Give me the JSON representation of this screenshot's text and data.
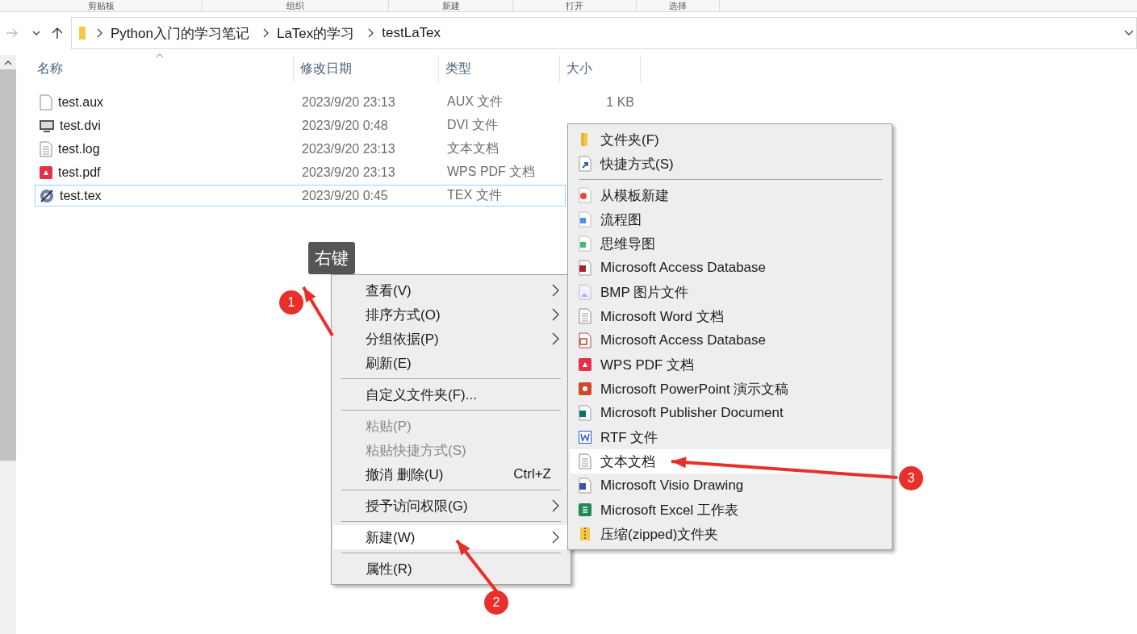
{
  "ribbon_groups": [
    "剪贴板",
    "组织",
    "新建",
    "打开",
    "选择"
  ],
  "breadcrumb": [
    "Python入门的学习笔记",
    "LaTex的学习",
    "testLaTex"
  ],
  "columns": [
    {
      "label": "名称",
      "sorted": true
    },
    {
      "label": "修改日期",
      "sorted": false
    },
    {
      "label": "类型",
      "sorted": false
    },
    {
      "label": "大小",
      "sorted": false
    }
  ],
  "files": [
    {
      "name": "test.aux",
      "date": "2023/9/20 23:13",
      "type": "AUX 文件",
      "size": "1 KB",
      "kind": "blank",
      "selected": false
    },
    {
      "name": "test.dvi",
      "date": "2023/9/20 0:48",
      "type": "DVI 文件",
      "kind": "dvi",
      "selected": false
    },
    {
      "name": "test.log",
      "date": "2023/9/20 23:13",
      "type": "文本文档",
      "kind": "text",
      "selected": false
    },
    {
      "name": "test.pdf",
      "date": "2023/9/20 23:13",
      "type": "WPS PDF 文档",
      "kind": "wpspdf",
      "selected": false
    },
    {
      "name": "test.tex",
      "date": "2023/9/20 0:45",
      "type": "TEX 文件",
      "kind": "tex",
      "selected": true
    }
  ],
  "context_menu": [
    {
      "kind": "item",
      "label": "查看(V)",
      "submenu": true,
      "disabled": false,
      "selected": false
    },
    {
      "kind": "item",
      "label": "排序方式(O)",
      "submenu": true,
      "disabled": false,
      "selected": false
    },
    {
      "kind": "item",
      "label": "分组依据(P)",
      "submenu": true,
      "disabled": false,
      "selected": false
    },
    {
      "kind": "item",
      "label": "刷新(E)",
      "submenu": false,
      "disabled": false,
      "selected": false
    },
    {
      "kind": "separator"
    },
    {
      "kind": "item",
      "label": "自定义文件夹(F)...",
      "submenu": false,
      "disabled": false,
      "selected": false
    },
    {
      "kind": "separator"
    },
    {
      "kind": "item",
      "label": "粘贴(P)",
      "submenu": false,
      "disabled": true,
      "selected": false
    },
    {
      "kind": "item",
      "label": "粘贴快捷方式(S)",
      "submenu": false,
      "disabled": true,
      "selected": false
    },
    {
      "kind": "item",
      "label": "撤消 删除(U)",
      "shortcut": "Ctrl+Z",
      "submenu": false,
      "disabled": false,
      "selected": false
    },
    {
      "kind": "separator"
    },
    {
      "kind": "item",
      "label": "授予访问权限(G)",
      "submenu": true,
      "disabled": false,
      "selected": false
    },
    {
      "kind": "separator"
    },
    {
      "kind": "item",
      "label": "新建(W)",
      "submenu": true,
      "disabled": false,
      "selected": true
    },
    {
      "kind": "separator"
    },
    {
      "kind": "item",
      "label": "属性(R)",
      "submenu": false,
      "disabled": false,
      "selected": false
    }
  ],
  "new_submenu": [
    {
      "kind": "folder",
      "label": "文件夹(F)",
      "selected": false
    },
    {
      "kind": "shortcut",
      "label": "快捷方式(S)",
      "selected": false
    },
    {
      "kind": "separator"
    },
    {
      "kind": "template",
      "label": "从模板新建",
      "selected": false
    },
    {
      "kind": "flowchart",
      "label": "流程图",
      "selected": false
    },
    {
      "kind": "mindmap",
      "label": "思维导图",
      "selected": false
    },
    {
      "kind": "access",
      "label": "Microsoft Access Database",
      "selected": false
    },
    {
      "kind": "bmp",
      "label": "BMP 图片文件",
      "selected": false
    },
    {
      "kind": "text",
      "label": "Microsoft Word 文档",
      "selected": false
    },
    {
      "kind": "access2",
      "label": "Microsoft Access Database",
      "selected": false
    },
    {
      "kind": "wpspdf",
      "label": "WPS PDF 文档",
      "selected": false
    },
    {
      "kind": "powerpoint",
      "label": "Microsoft PowerPoint 演示文稿",
      "selected": false
    },
    {
      "kind": "publisher",
      "label": "Microsoft Publisher Document",
      "selected": false
    },
    {
      "kind": "rtf",
      "label": "RTF 文件",
      "selected": false
    },
    {
      "kind": "text",
      "label": "文本文档",
      "selected": true
    },
    {
      "kind": "visio",
      "label": "Microsoft Visio Drawing",
      "selected": false
    },
    {
      "kind": "excel",
      "label": "Microsoft Excel 工作表",
      "selected": false
    },
    {
      "kind": "zip",
      "label": "压缩(zipped)文件夹",
      "selected": false
    }
  ],
  "annotations": [
    {
      "number": "1",
      "tooltip": "右键"
    },
    {
      "number": "2"
    },
    {
      "number": "3"
    }
  ]
}
